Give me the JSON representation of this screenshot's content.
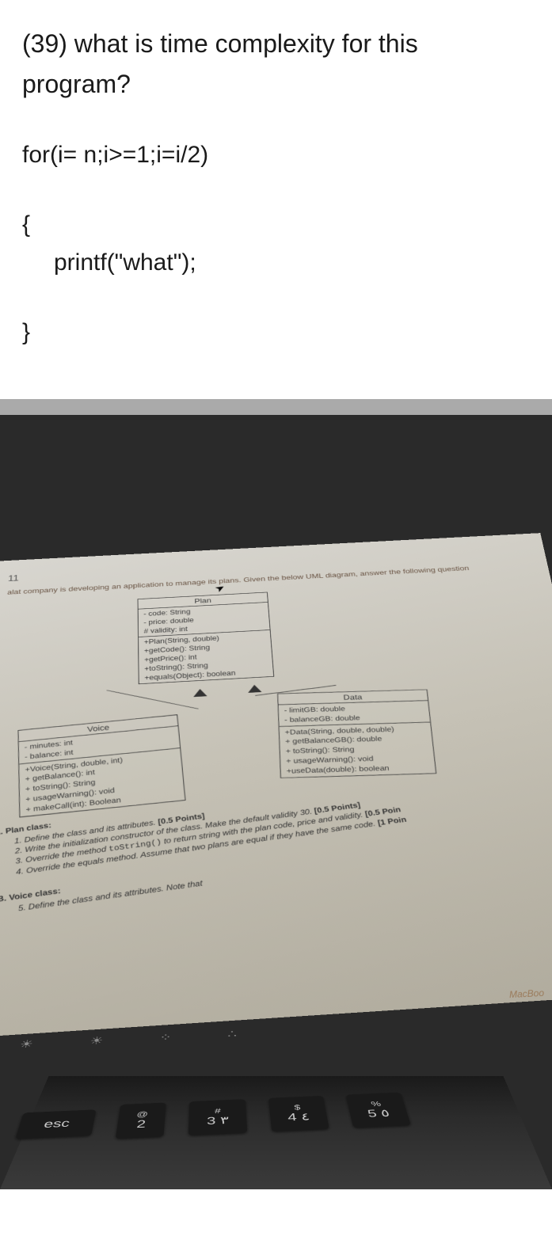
{
  "q1": {
    "title": "(39) what is time complexity for this program?",
    "line1": "for(i= n;i>=1;i=i/2)",
    "line2": "{",
    "line3": "printf(\"what\");",
    "line4": "}"
  },
  "q2": {
    "pagenum": "11",
    "prompt": "alat company is developing an application to manage its plans. Given the below UML diagram, answer the following question",
    "plan": {
      "name": "Plan",
      "attrs": "- code: String\n- price: double\n# validity: int",
      "ops": "+Plan(String, double)\n+getCode(): String\n+getPrice(): int\n+toString(): String\n+equals(Object): boolean"
    },
    "voice": {
      "name": "Voice",
      "attrs": "- minutes: int\n- balance: int",
      "ops": "+Voice(String, double, int)\n+ getBalance(): int\n+ toString(): String\n+ usageWarning(): void\n+ makeCall(int): Boolean"
    },
    "data": {
      "name": "Data",
      "attrs": "- limitGB: double\n- balanceGB: double",
      "ops": "+Data(String, double, double)\n+ getBalanceGB(): double\n+ toString(): String\n+ usageWarning(): void\n+useData(double): boolean"
    },
    "tasks": {
      "a_header": "A. Plan class:",
      "a1_pre": "Define the class and its attributes. ",
      "a1_pts": "[0.5 Points]",
      "a2_pre": "Write the initialization constructor of the class. Make the default validity 30. ",
      "a2_pts": "[0.5 Points]",
      "a3_pre": "Override the method ",
      "a3_code": "toString()",
      "a3_post": " to return string with the plan code, price and validity. ",
      "a3_pts": "[0.5 Poin",
      "a4_pre": "Override the equals method. Assume that two plans are equal if they have the same code. ",
      "a4_pts": "[1 Poin",
      "b_header": "B. Voice class:",
      "b5": "Define the class and its attributes. Note that"
    },
    "macbook": "MacBoo",
    "keys": {
      "esc": "esc",
      "at": "@",
      "hash": "#",
      "dollar": "$",
      "percent": "%",
      "n2": "2",
      "n3": "3",
      "n4": "4",
      "n5": "5",
      "ar3": "٣",
      "ar4": "٤",
      "ar5": "٥"
    }
  }
}
